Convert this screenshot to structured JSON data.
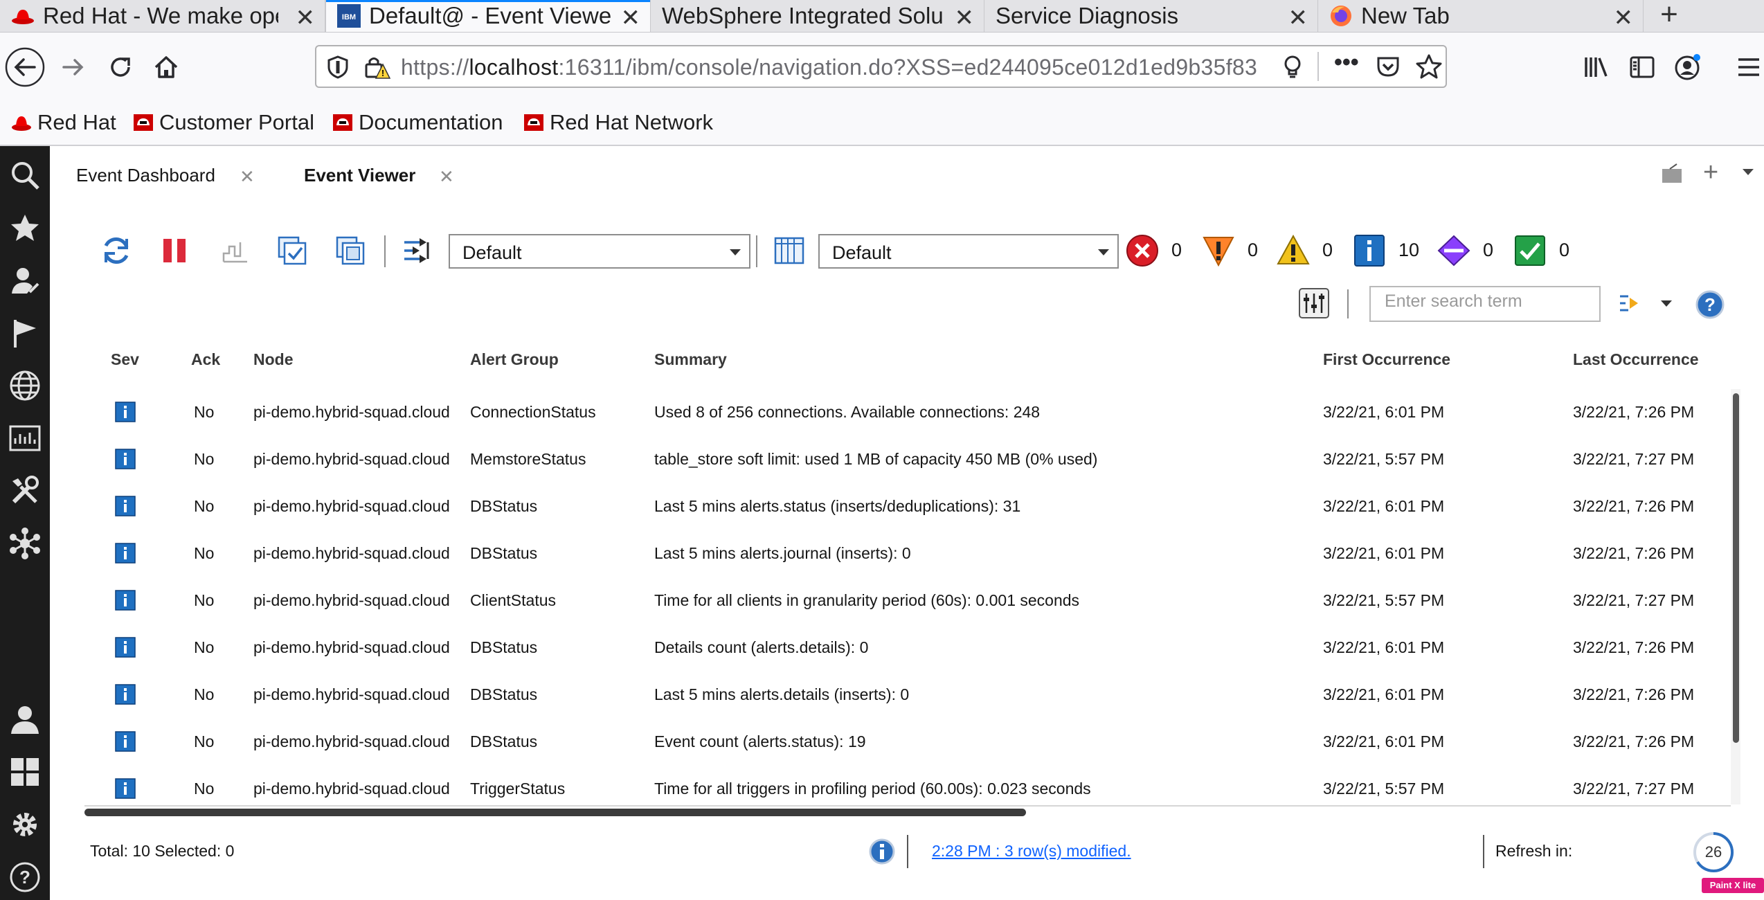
{
  "browser": {
    "tabs": [
      {
        "title": "Red Hat - We make open source technologies for the enterprise",
        "favicon": "redhat-icon",
        "active": false
      },
      {
        "title": "Default@ - Event Viewer",
        "favicon": "ibm-icon",
        "active": true
      },
      {
        "title": "WebSphere Integrated Solutions Console",
        "favicon": "",
        "active": false
      },
      {
        "title": "Service Diagnosis",
        "favicon": "",
        "active": false
      },
      {
        "title": "New Tab",
        "favicon": "firefox-icon",
        "active": false
      }
    ],
    "url_prefix": "https://",
    "url_host": "localhost",
    "url_rest": ":16311/ibm/console/navigation.do?XSS=ed244095ce012d1ed9b35f83",
    "bookmarks": [
      "Red Hat",
      "Customer Portal",
      "Documentation",
      "Red Hat Network"
    ]
  },
  "console": {
    "tabs": [
      {
        "label": "Event Dashboard",
        "active": false
      },
      {
        "label": "Event Viewer",
        "active": true
      }
    ]
  },
  "toolbar": {
    "filter_value": "Default",
    "view_value": "Default",
    "counts": {
      "critical": "0",
      "major": "0",
      "minor": "0",
      "info": "10",
      "indeterminate": "0",
      "clear": "0"
    },
    "search_placeholder": "Enter search term"
  },
  "table": {
    "headers": [
      "Sev",
      "Ack",
      "Node",
      "Alert Group",
      "Summary",
      "First Occurrence",
      "Last Occurrence"
    ],
    "rows": [
      {
        "ack": "No",
        "node": "pi-demo.hybrid-squad.cloud",
        "group": "ConnectionStatus",
        "summary": "Used 8 of 256 connections. Available connections: 248",
        "first": "3/22/21, 6:01 PM",
        "last": "3/22/21, 7:26 PM"
      },
      {
        "ack": "No",
        "node": "pi-demo.hybrid-squad.cloud",
        "group": "MemstoreStatus",
        "summary": "table_store soft limit: used 1 MB of capacity 450 MB (0% used)",
        "first": "3/22/21, 5:57 PM",
        "last": "3/22/21, 7:27 PM"
      },
      {
        "ack": "No",
        "node": "pi-demo.hybrid-squad.cloud",
        "group": "DBStatus",
        "summary": "Last 5 mins alerts.status (inserts/deduplications): 31",
        "first": "3/22/21, 6:01 PM",
        "last": "3/22/21, 7:26 PM"
      },
      {
        "ack": "No",
        "node": "pi-demo.hybrid-squad.cloud",
        "group": "DBStatus",
        "summary": "Last 5 mins alerts.journal (inserts): 0",
        "first": "3/22/21, 6:01 PM",
        "last": "3/22/21, 7:26 PM"
      },
      {
        "ack": "No",
        "node": "pi-demo.hybrid-squad.cloud",
        "group": "ClientStatus",
        "summary": "Time for all clients in granularity period (60s): 0.001 seconds",
        "first": "3/22/21, 5:57 PM",
        "last": "3/22/21, 7:27 PM"
      },
      {
        "ack": "No",
        "node": "pi-demo.hybrid-squad.cloud",
        "group": "DBStatus",
        "summary": "Details count (alerts.details): 0",
        "first": "3/22/21, 6:01 PM",
        "last": "3/22/21, 7:26 PM"
      },
      {
        "ack": "No",
        "node": "pi-demo.hybrid-squad.cloud",
        "group": "DBStatus",
        "summary": "Last 5 mins alerts.details (inserts): 0",
        "first": "3/22/21, 6:01 PM",
        "last": "3/22/21, 7:26 PM"
      },
      {
        "ack": "No",
        "node": "pi-demo.hybrid-squad.cloud",
        "group": "DBStatus",
        "summary": "Event count (alerts.status): 19",
        "first": "3/22/21, 6:01 PM",
        "last": "3/22/21, 7:26 PM"
      },
      {
        "ack": "No",
        "node": "pi-demo.hybrid-squad.cloud",
        "group": "TriggerStatus",
        "summary": "Time for all triggers in profiling period (60.00s): 0.023 seconds",
        "first": "3/22/21, 5:57 PM",
        "last": "3/22/21, 7:27 PM"
      }
    ]
  },
  "status": {
    "totals": "Total: 10 Selected: 0",
    "modified": "2:28 PM : 3 row(s) modified.",
    "refresh_label": "Refresh in:",
    "refresh_seconds": "26",
    "badge": "Paint X lite"
  },
  "colors": {
    "sidebar_bg": "#1c1c1c",
    "info_blue": "#1f70c1",
    "critical_red": "#da1e28",
    "link_blue": "#0f62fe",
    "firefox_accent": "#0a84ff"
  }
}
